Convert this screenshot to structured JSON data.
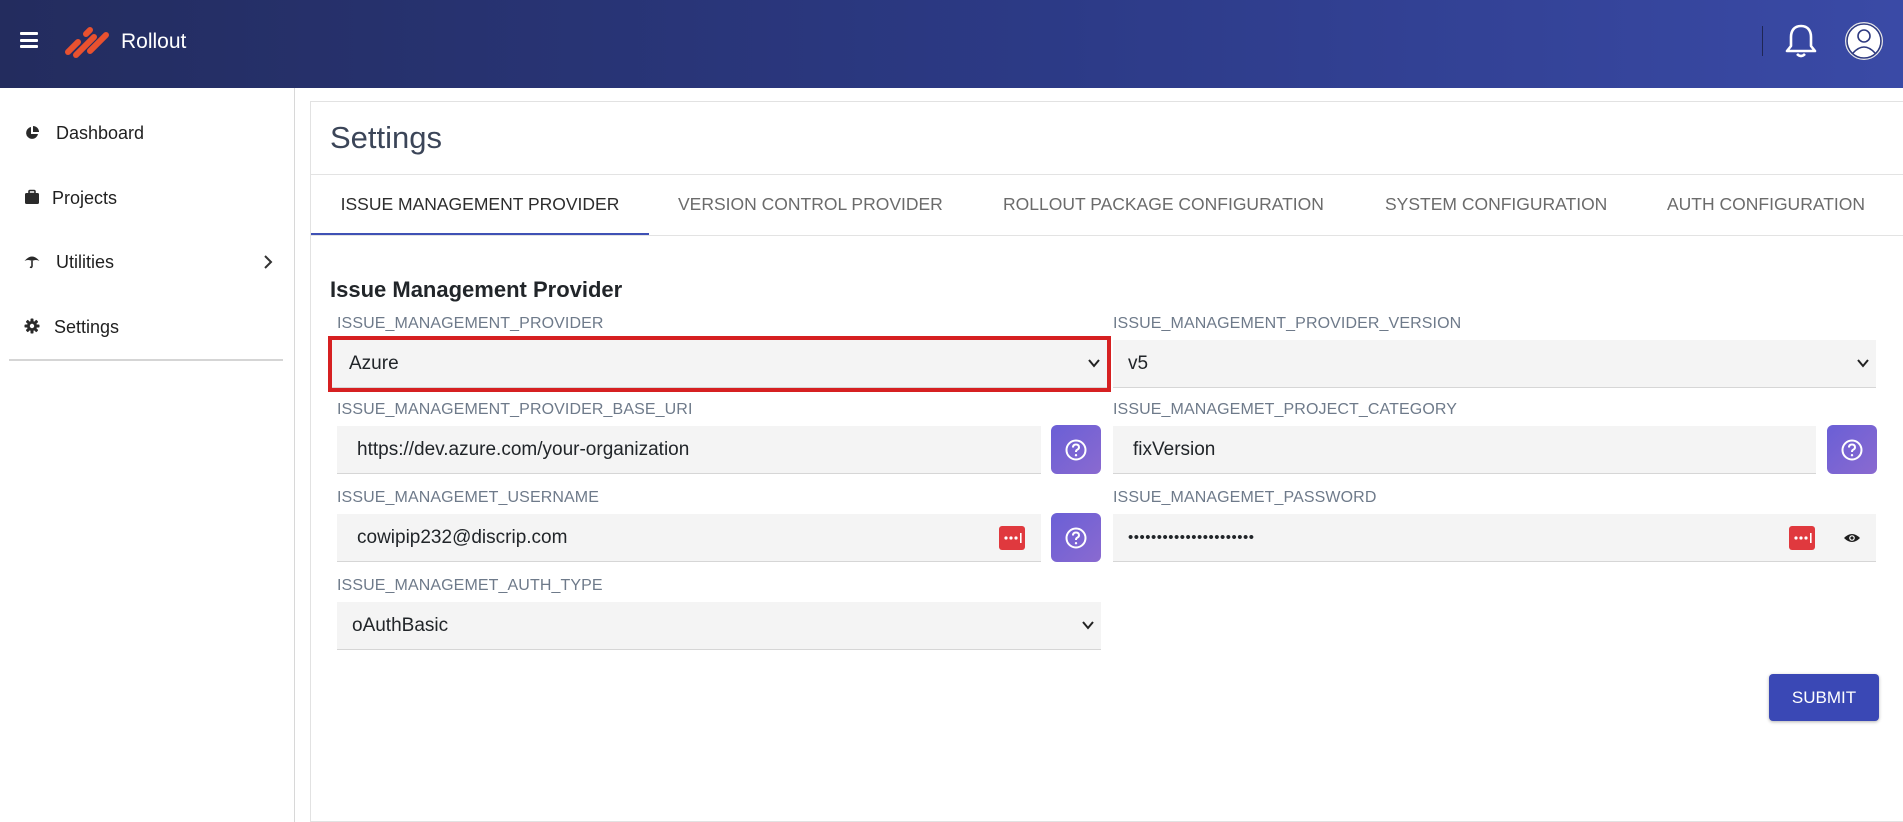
{
  "header": {
    "brand": "Rollout",
    "icons": [
      "menu-icon",
      "rollout-logo",
      "bell-icon",
      "user-avatar-icon"
    ]
  },
  "sidebar": {
    "items": [
      {
        "label": "Dashboard",
        "icon": "pie-chart-icon"
      },
      {
        "label": "Projects",
        "icon": "briefcase-icon"
      },
      {
        "label": "Utilities",
        "icon": "umbrella-icon"
      },
      {
        "label": "Settings",
        "icon": "gear-icon"
      }
    ]
  },
  "main": {
    "title": "Settings",
    "tabs": [
      {
        "label": "ISSUE MANAGEMENT PROVIDER",
        "active": true
      },
      {
        "label": "VERSION CONTROL PROVIDER",
        "active": false
      },
      {
        "label": "ROLLOUT PACKAGE CONFIGURATION",
        "active": false
      },
      {
        "label": "SYSTEM CONFIGURATION",
        "active": false
      },
      {
        "label": "AUTH CONFIGURATION",
        "active": false
      }
    ],
    "section_title": "Issue Management Provider",
    "fields": {
      "provider": {
        "label": "ISSUE_MANAGEMENT_PROVIDER",
        "value": "Azure"
      },
      "provider_version": {
        "label": "ISSUE_MANAGEMENT_PROVIDER_VERSION",
        "value": "v5"
      },
      "base_uri": {
        "label": "ISSUE_MANAGEMENT_PROVIDER_BASE_URI",
        "value": "https://dev.azure.com/your-organization"
      },
      "project_category": {
        "label": "ISSUE_MANAGEMET_PROJECT_CATEGORY",
        "value": "fixVersion"
      },
      "username": {
        "label": "ISSUE_MANAGEMET_USERNAME",
        "value": "cowipip232@discrip.com"
      },
      "password": {
        "label": "ISSUE_MANAGEMET_PASSWORD",
        "value": "••••••••••••••••••••••"
      },
      "auth_type": {
        "label": "ISSUE_MANAGEMET_AUTH_TYPE",
        "value": "oAuthBasic"
      }
    },
    "submit_label": "SUBMIT"
  },
  "colors": {
    "header_gradient_start": "#232c5e",
    "header_gradient_end": "#3a4aa6",
    "accent": "#3f51b5",
    "highlight": "#d62021",
    "help_button": "#7466d4",
    "password_manager": "#e0393e"
  }
}
